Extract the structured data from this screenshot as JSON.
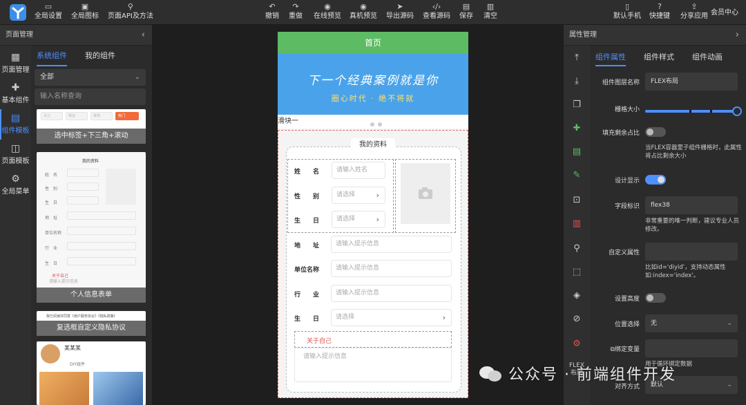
{
  "toolbar": {
    "left": [
      {
        "label": "全局设置",
        "icon": "folder-icon"
      },
      {
        "label": "全局图标",
        "icon": "image-icon"
      },
      {
        "label": "页面API及方法",
        "icon": "plug-icon"
      }
    ],
    "center": [
      {
        "label": "撤销",
        "icon": "undo-icon"
      },
      {
        "label": "重做",
        "icon": "redo-icon"
      },
      {
        "label": "在线预览",
        "icon": "eye-icon"
      },
      {
        "label": "真机预览",
        "icon": "eye-icon"
      },
      {
        "label": "导出源码",
        "icon": "send-icon"
      },
      {
        "label": "查看源码",
        "icon": "code-icon"
      },
      {
        "label": "保存",
        "icon": "save-icon"
      },
      {
        "label": "清空",
        "icon": "trash-icon"
      }
    ],
    "right": [
      {
        "label": "默认手机",
        "icon": "phone-icon"
      },
      {
        "label": "快捷键",
        "icon": "help-icon"
      },
      {
        "label": "分享应用",
        "icon": "share-icon"
      },
      {
        "label": "会员中心",
        "icon": ""
      }
    ]
  },
  "left_panel": {
    "title": "页面管理",
    "side": [
      "页面管理",
      "基本组件",
      "组件模板",
      "页面模板",
      "全局菜单"
    ],
    "tabs": [
      "系统组件",
      "我的组件"
    ],
    "select_value": "全部",
    "search_placeholder": "输入名称查询",
    "cards": [
      {
        "caption": "选中标签+下三角+滚动",
        "buttons": [
          "关注",
          "精选",
          "推荐",
          "热门"
        ]
      },
      {
        "caption": "个人信息表单",
        "title": "我的资料",
        "fields": [
          "姓　名",
          "性　别",
          "生　日",
          "地　址",
          "单位名称",
          "行　业",
          "生　日"
        ],
        "about": "关于自己",
        "about_ph": "请输入提示信息"
      },
      {
        "caption": "复选框自定义隐私协议",
        "text": "我已阅读并同意《用户服务协议》《隐私政策》"
      },
      {
        "caption": "",
        "name": "某某某",
        "tag": "DIY组件"
      }
    ]
  },
  "canvas": {
    "page_title": "首页",
    "banner_line1": "下一个经典案例就是你",
    "banner_line2": "圈心时代 · 绝不将就",
    "slide_label": "滑块一",
    "form_title": "我的资料",
    "fields": {
      "name": {
        "label": "姓　　名",
        "placeholder": "请输入姓名"
      },
      "gender": {
        "label": "性　　别",
        "placeholder": "请选择"
      },
      "birthday": {
        "label": "生　　日",
        "placeholder": "请选择"
      },
      "address": {
        "label": "地　　址",
        "placeholder": "请输入提示信息"
      },
      "company": {
        "label": "单位名称",
        "placeholder": "请输入提示信息"
      },
      "industry": {
        "label": "行　　业",
        "placeholder": "请输入提示信息"
      },
      "birthday2": {
        "label": "生　　日",
        "placeholder": "请选择"
      }
    },
    "about_label": "关于自己",
    "about_placeholder": "请输入提示信息"
  },
  "right_panel": {
    "title": "属性管理",
    "tabs": [
      "组件属性",
      "组件样式",
      "组件动画"
    ],
    "flex_label": "FLEX\n布局",
    "props": {
      "layer_name_label": "组件图层名称",
      "layer_name_value": "FLEX布局",
      "grid_size_label": "栅格大小",
      "fill_label": "填充剩余占比",
      "fill_hint": "当FLEX容器里子组件栅格时，此属性将占比剩余大小",
      "design_show_label": "设计显示",
      "field_id_label": "字段标识",
      "field_id_value": "flex38",
      "field_id_hint": "非常重要的唯一判断，建议专业人员修改。",
      "custom_attr_label": "自定义属性",
      "custom_attr_hint": "比如id='diyid'，支持动态属性如:index='index'。",
      "height_label": "设置高度",
      "position_label": "位置选择",
      "position_value": "无",
      "bind_label": "绑定变量",
      "bind_hint": "用于循环绑定数据",
      "align_label": "对齐方式",
      "align_value": "默认"
    },
    "toggles": {
      "fill": false,
      "design_show": true,
      "height": false
    },
    "grid_size_fraction": 1.0
  },
  "watermark": "公众号 · 前端组件开发",
  "colors": {
    "accent": "#4d90ff",
    "header_green": "#5dbb63",
    "banner_blue": "#4aa3ea",
    "danger": "#e05050"
  }
}
